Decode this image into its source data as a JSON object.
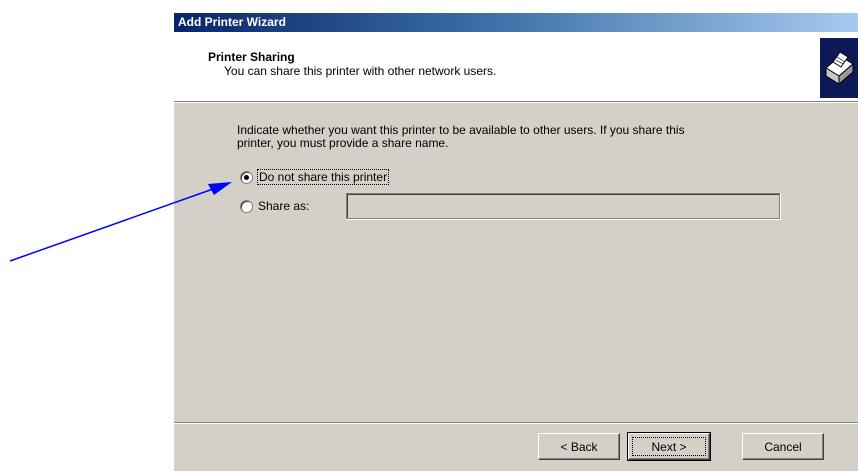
{
  "window": {
    "title": "Add Printer Wizard"
  },
  "header": {
    "title": "Printer Sharing",
    "subtitle": "You can share this printer with other network users.",
    "icon": "printer-icon"
  },
  "instructions": {
    "line1": "Indicate whether you want this printer to be available to other users. If you share this",
    "line2": "printer, you must provide a share name."
  },
  "options": {
    "do_not_share": {
      "label": "Do not share this printer",
      "selected": true
    },
    "share_as": {
      "label": "Share as:",
      "selected": false,
      "value": ""
    }
  },
  "buttons": {
    "back": "< Back",
    "next": "Next >",
    "cancel": "Cancel"
  },
  "annotation": {
    "color": "#0000ff",
    "icon": "arrow"
  }
}
